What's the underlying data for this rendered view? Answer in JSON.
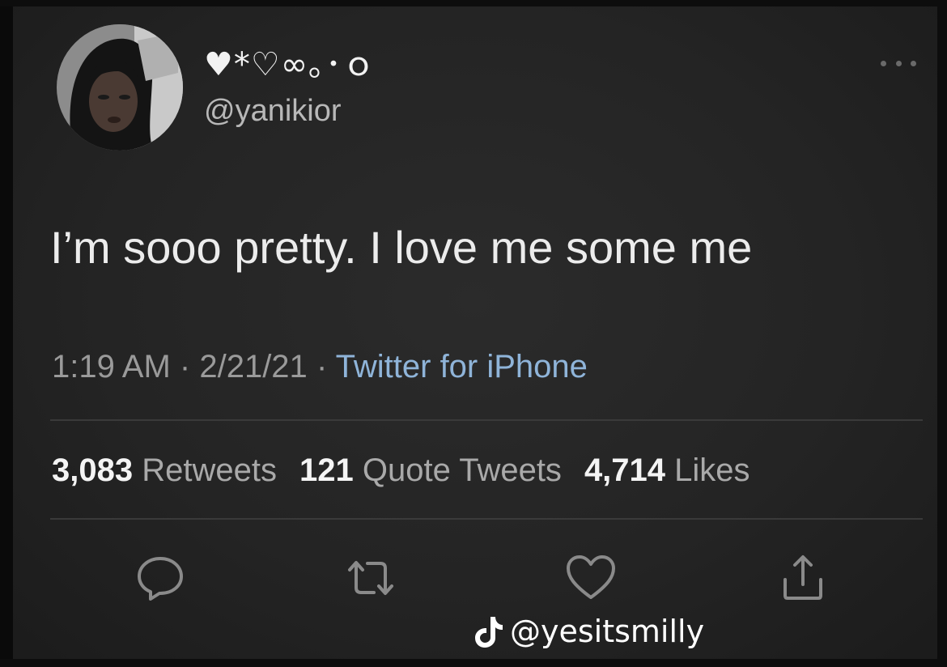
{
  "tweet": {
    "display_name": "♥*♡∞｡･ｏ",
    "handle": "@yanikior",
    "text": "I’m sooo pretty. I love me some me",
    "time": "1:19 AM",
    "date": "2/21/21",
    "separator": "·",
    "source": "Twitter for iPhone"
  },
  "stats": {
    "retweets_count": "3,083",
    "retweets_label": "Retweets",
    "quotes_count": "121",
    "quotes_label": "Quote Tweets",
    "likes_count": "4,714",
    "likes_label": "Likes"
  },
  "actions": {
    "reply_icon": "reply-icon",
    "retweet_icon": "retweet-icon",
    "like_icon": "heart-icon",
    "share_icon": "share-icon"
  },
  "watermark": {
    "platform_icon": "tiktok-logo",
    "handle": "@yesitsmilly"
  },
  "colors": {
    "background": "#262626",
    "text_primary": "#ececec",
    "text_secondary": "#9a9a9a",
    "link": "#8fb4d9"
  }
}
